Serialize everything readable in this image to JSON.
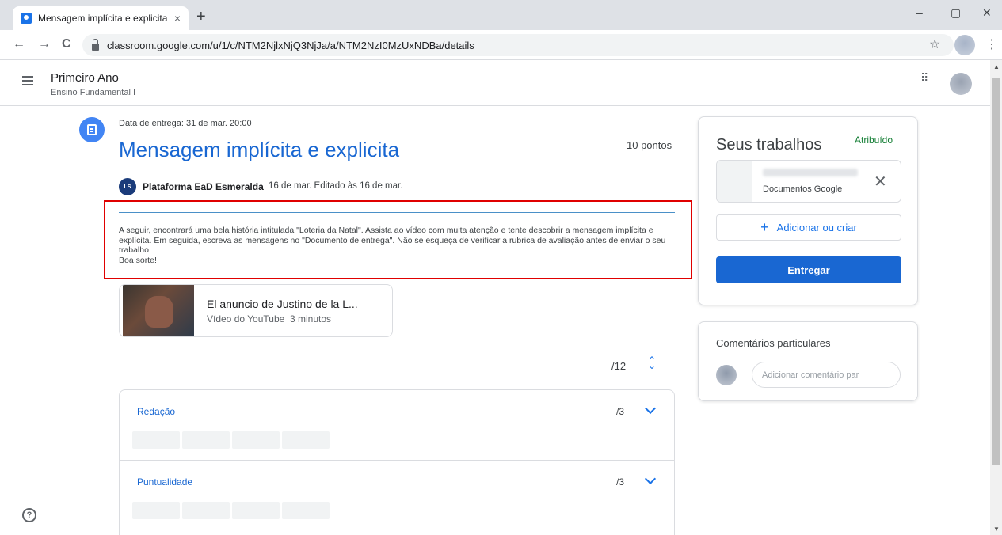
{
  "browser": {
    "tab_title": "Mensagem implícita e explicita",
    "tab_close": "×",
    "new_tab": "+",
    "url": "classroom.google.com/u/1/c/NTM2NjlxNjQ3NjJa/a/NTM2NzI0MzUxNDBa/details",
    "minimize": "–",
    "restore": "▢",
    "close": "✕",
    "back": "←",
    "forward": "→",
    "reload": "C",
    "star": "☆",
    "menu": "⋮"
  },
  "header": {
    "class_name": "Primeiro Ano",
    "class_section": "Ensino Fundamental I",
    "apps_icon": "⠿"
  },
  "assignment": {
    "due": "Data de entrega: 31 de mar. 20:00",
    "title": "Mensagem implícita e explicita",
    "points": "10 pontos",
    "author_avatar_text": "La Salle",
    "author": "Plataforma EaD Esmeralda",
    "date": "16 de mar. Editado às 16 de mar.",
    "description": "A seguir, encontrará uma bela história intitulada \"Loteria da Natal\". Assista ao vídeo com muita atenção e tente descobrir a mensagem implícita e explícita. Em seguida, escreva as mensagens no \"Documento de entrega\". Não se esqueça de verificar a rubrica de avaliação antes de enviar o seu trabalho.",
    "closing": "Boa sorte!",
    "highlight_color": "#e00000"
  },
  "video": {
    "title": "El anuncio de Justino de la L...",
    "source": "Vídeo do YouTube",
    "duration": "3 minutos"
  },
  "rubric": {
    "total": "/12",
    "toggle_icon": "⌃⌄",
    "criteria": [
      {
        "name": "Redação",
        "score": "/3"
      },
      {
        "name": "Puntualidade",
        "score": "/3"
      }
    ]
  },
  "work": {
    "title": "Seus trabalhos",
    "status": "Atribuído",
    "status_color": "#188038",
    "attachment_type": "Documentos Google",
    "remove_icon": "✕",
    "add_label": "Adicionar ou criar",
    "add_icon": "+",
    "submit_label": "Entregar",
    "accent": "#1967d2"
  },
  "comments": {
    "title": "Comentários particulares",
    "placeholder": "Adicionar comentário par"
  },
  "help_icon": "?"
}
